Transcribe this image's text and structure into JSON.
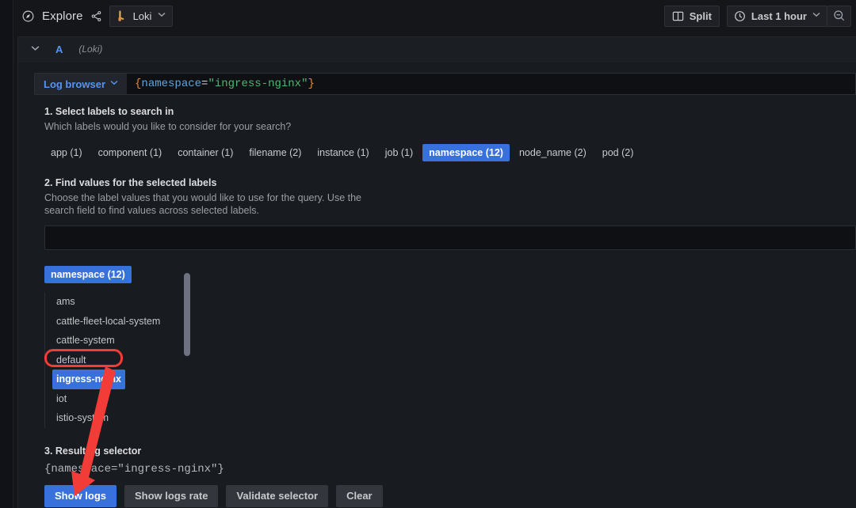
{
  "toolbar": {
    "explore_icon": "compass-icon",
    "title": "Explore",
    "share_icon": "share-icon",
    "datasource": {
      "icon": "loki-logo-icon",
      "name": "Loki",
      "chevron": "∨"
    },
    "split": {
      "icon": "split-panes-icon",
      "label": "Split"
    },
    "time_picker": {
      "icon": "clock-icon",
      "label": "Last 1 hour",
      "chevron": "∨"
    },
    "zoom_out_icon": "zoom-out-icon"
  },
  "query_row": {
    "collapse_chevron": "∨",
    "ref_id": "A",
    "datasource_label": "(Loki)"
  },
  "query_editor": {
    "log_browser_label": "Log browser",
    "log_browser_chevron": "∨",
    "expression": {
      "open_brace": "{",
      "key": "namespace",
      "equals": "=",
      "value": "\"ingress-nginx\"",
      "close_brace": "}"
    }
  },
  "label_browser": {
    "step1": {
      "title": "1. Select labels to search in",
      "description": "Which labels would you like to consider for your search?",
      "labels": [
        {
          "name": "app (1)",
          "selected": false
        },
        {
          "name": "component (1)",
          "selected": false
        },
        {
          "name": "container (1)",
          "selected": false
        },
        {
          "name": "filename (2)",
          "selected": false
        },
        {
          "name": "instance (1)",
          "selected": false
        },
        {
          "name": "job (1)",
          "selected": false
        },
        {
          "name": "namespace (12)",
          "selected": true
        },
        {
          "name": "node_name (2)",
          "selected": false
        },
        {
          "name": "pod (2)",
          "selected": false
        }
      ]
    },
    "step2": {
      "title": "2. Find values for the selected labels",
      "description": "Choose the label values that you would like to use for the query. Use the search field to find values across selected labels.",
      "search_value": "",
      "search_placeholder": "",
      "value_column": {
        "title": "namespace (12)",
        "values": [
          {
            "name": "ams",
            "selected": false
          },
          {
            "name": "cattle-fleet-local-system",
            "selected": false
          },
          {
            "name": "cattle-system",
            "selected": false
          },
          {
            "name": "default",
            "selected": false
          },
          {
            "name": "ingress-nginx",
            "selected": true
          },
          {
            "name": "iot",
            "selected": false
          },
          {
            "name": "istio-system",
            "selected": false
          }
        ]
      }
    },
    "step3": {
      "title": "3. Resulting selector",
      "selector": "{namespace=\"ingress-nginx\"}",
      "buttons": [
        {
          "label": "Show logs",
          "style": "primary"
        },
        {
          "label": "Show logs rate",
          "style": "secondary"
        },
        {
          "label": "Validate selector",
          "style": "secondary"
        },
        {
          "label": "Clear",
          "style": "secondary"
        }
      ]
    }
  },
  "annotations": {
    "highlight_box_target": "ingress-nginx",
    "arrow_target": "Show logs",
    "color": "#f23c37"
  },
  "colors": {
    "accent_blue": "#3871dc",
    "link_blue": "#5794f2",
    "panel_bg": "#181b1f",
    "app_bg": "#141619",
    "annotation_red": "#f23c37"
  }
}
